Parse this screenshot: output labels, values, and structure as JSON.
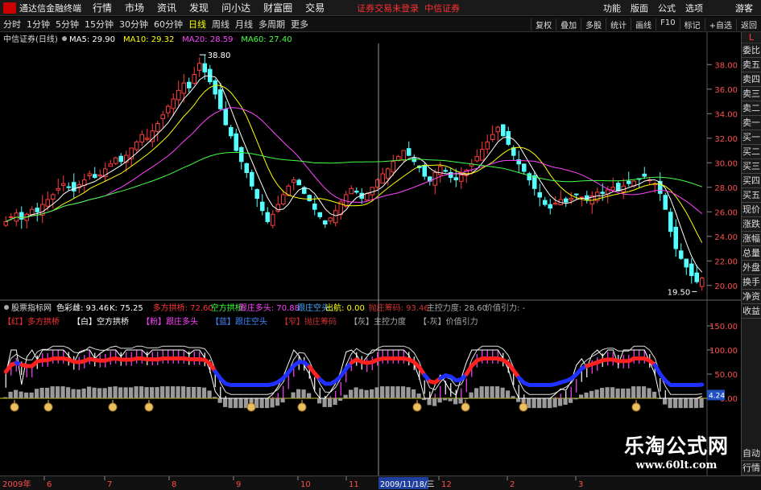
{
  "menubar": {
    "app_title": "通达信金融终端",
    "menus": [
      "行情",
      "市场",
      "资讯",
      "发现",
      "问小达",
      "财富圈",
      "交易"
    ],
    "notice": "证券交易未登录",
    "broker": "中信证券",
    "right_buttons": [
      "功能",
      "版面",
      "公式",
      "选项"
    ],
    "guest": "游客"
  },
  "periodbar": {
    "periods": [
      "分时",
      "1分钟",
      "5分钟",
      "15分钟",
      "30分钟",
      "60分钟",
      "日线",
      "周线",
      "月线",
      "多周期",
      "更多"
    ],
    "active_period": "日线",
    "tools": [
      "复权",
      "叠加",
      "多股",
      "统计",
      "画线",
      "F10",
      "标记",
      "+自选",
      "返回"
    ]
  },
  "main_chart": {
    "title": "中信证券(日线)",
    "ma": [
      {
        "label": "MA5: 29.90",
        "color": "#ffffff"
      },
      {
        "label": "MA10: 29.32",
        "color": "#ffff00"
      },
      {
        "label": "MA20: 28.59",
        "color": "#ff44ff"
      },
      {
        "label": "MA60: 27.40",
        "color": "#44ff44"
      }
    ],
    "high_label": "38.80",
    "low_label": "19.50",
    "price_ticks": [
      "38.00",
      "36.00",
      "34.00",
      "32.00",
      "30.00",
      "28.00",
      "26.00",
      "24.00",
      "22.00",
      "20.00"
    ]
  },
  "indicator": {
    "name": "股票指标网",
    "values": [
      {
        "label": "色彩雌: 93.46",
        "color": "#ffffff"
      },
      {
        "label": "K: 75.25",
        "color": "#ffffff"
      },
      {
        "label": "多方拱桥: 72.60",
        "color": "#ff3333"
      },
      {
        "label": "空方拱桥:",
        "color": "#33ff33"
      },
      {
        "label": "跟庄多头: 70.88",
        "color": "#ff44ff"
      },
      {
        "label": "跟庄空头:",
        "color": "#44aaff"
      },
      {
        "label": "出航: 0.00",
        "color": "#ffff00"
      },
      {
        "label": "抛庄筹码: 93.46",
        "color": "#cc3333"
      },
      {
        "label": "主控力度: 28.60",
        "color": "#aaaaaa"
      },
      {
        "label": "价值引力: -",
        "color": "#aaaaaa"
      }
    ],
    "legend": [
      {
        "label": "【红】多方拱桥",
        "color": "#ff3333"
      },
      {
        "label": "【白】空方拱桥",
        "color": "#ffffff"
      },
      {
        "label": "【粉】跟庄多头",
        "color": "#ff44ff"
      },
      {
        "label": "【蓝】跟庄空头",
        "color": "#4488ff"
      },
      {
        "label": "【窄】抛庄筹码",
        "color": "#cc3333"
      },
      {
        "label": "【灰】主控力度",
        "color": "#aaaaaa"
      },
      {
        "label": "【-灰】价值引力",
        "color": "#aaaaaa"
      }
    ],
    "ticks": [
      "150.00",
      "100.00",
      "50.00",
      "0.00"
    ],
    "current_value": "4.24"
  },
  "dates": {
    "year_label": "2009年",
    "months": [
      "6",
      "7",
      "8",
      "9",
      "10",
      "11",
      "12",
      "2",
      "3"
    ],
    "cursor_date": "2009/11/18/三"
  },
  "sidebar": {
    "items": [
      "L",
      "委比",
      "卖五",
      "卖四",
      "卖三",
      "卖二",
      "卖一",
      "买一",
      "买二",
      "买三",
      "买四",
      "买五",
      "现价",
      "涨跌",
      "涨幅",
      "总量",
      "外盘",
      "换手",
      "净资",
      "收益"
    ],
    "bottom": [
      "自动",
      "行情"
    ]
  },
  "watermark": {
    "line1": "乐淘公式网",
    "line2": "www.60lt.com"
  },
  "chart_data": {
    "type": "candlestick",
    "title": "中信证券(日线)",
    "y_ticks": [
      20,
      22,
      24,
      26,
      28,
      30,
      32,
      34,
      36,
      38
    ],
    "ylim": [
      19,
      39.2
    ],
    "close": [
      25.2,
      25.6,
      25.9,
      25.4,
      25.8,
      26.2,
      26.0,
      26.6,
      27.0,
      27.4,
      27.9,
      28.3,
      28.0,
      27.7,
      28.2,
      28.6,
      29.1,
      28.8,
      29.0,
      29.5,
      29.9,
      30.4,
      30.1,
      30.6,
      31.2,
      31.7,
      32.3,
      32.0,
      32.6,
      33.2,
      33.9,
      34.6,
      35.2,
      35.9,
      36.5,
      36.1,
      37.2,
      38.1,
      37.4,
      36.6,
      35.6,
      34.4,
      33.1,
      32.2,
      31.0,
      30.1,
      29.2,
      28.1,
      27.1,
      26.1,
      25.2,
      25.8,
      26.6,
      27.4,
      28.1,
      28.6,
      28.2,
      27.5,
      26.9,
      26.2,
      25.6,
      25.0,
      25.5,
      26.1,
      26.8,
      27.4,
      27.9,
      27.6,
      27.1,
      27.5,
      28.0,
      28.6,
      29.1,
      29.5,
      30.1,
      30.5,
      31.0,
      30.6,
      30.1,
      29.6,
      28.9,
      28.5,
      29.2,
      29.7,
      29.3,
      28.8,
      28.6,
      29.0,
      29.4,
      29.9,
      30.5,
      31.1,
      31.7,
      32.3,
      32.9,
      32.2,
      31.5,
      30.6,
      29.9,
      29.3,
      28.6,
      27.9,
      27.2,
      26.6,
      26.3,
      26.7,
      27.0,
      26.8,
      27.1,
      27.4,
      27.2,
      27.0,
      27.3,
      27.6,
      27.5,
      27.8,
      28.0,
      27.7,
      28.1,
      28.3,
      28.5,
      28.7,
      28.9,
      28.6,
      28.3,
      27.5,
      26.2,
      24.4,
      23.0,
      22.2,
      21.5,
      20.8,
      20.3,
      20.6
    ]
  }
}
